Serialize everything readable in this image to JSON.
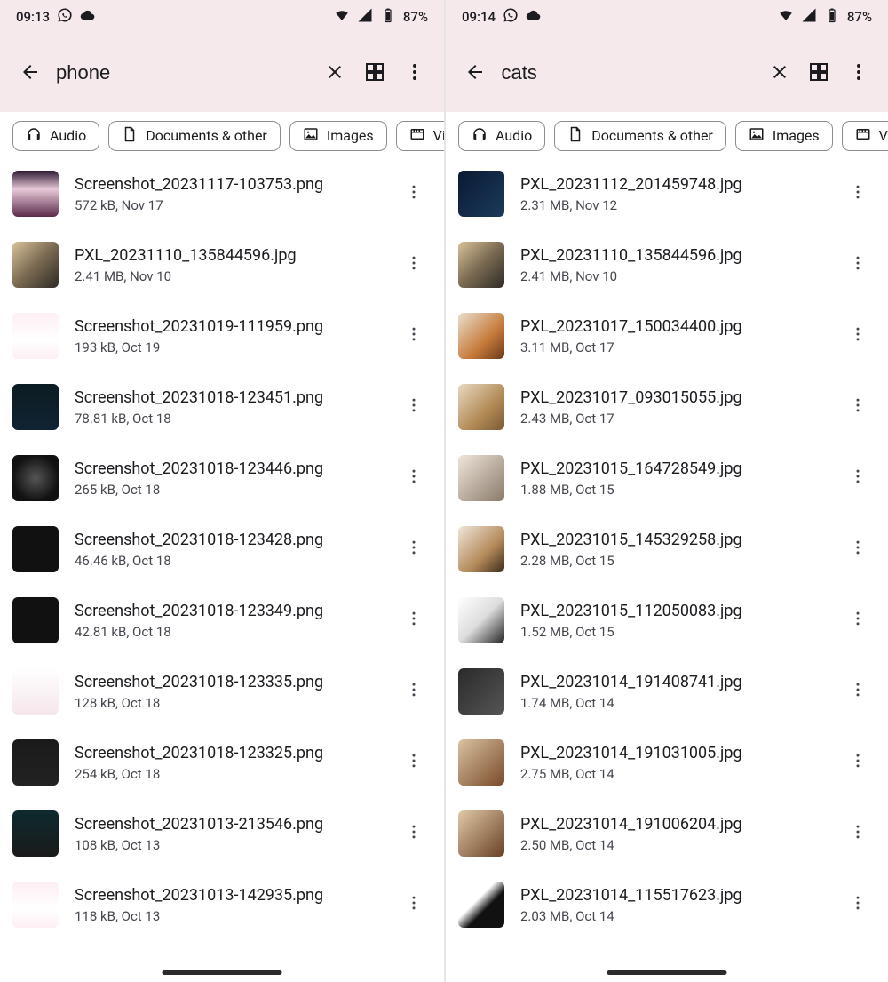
{
  "battery_label": "87%",
  "chips": [
    {
      "icon": "headphones",
      "label": "Audio"
    },
    {
      "icon": "doc",
      "label": "Documents & other"
    },
    {
      "icon": "image",
      "label": "Images"
    },
    {
      "icon": "video",
      "label": "Vi"
    }
  ],
  "panes": [
    {
      "time": "09:13",
      "query": "phone",
      "files": [
        {
          "name": "Screenshot_20231117-103753.png",
          "meta": "572 kB, Nov 17",
          "thumb": "ss-pink"
        },
        {
          "name": "PXL_20231110_135844596.jpg",
          "meta": "2.41 MB, Nov 10",
          "thumb": "cat-laptop"
        },
        {
          "name": "Screenshot_20231019-111959.png",
          "meta": "193 kB, Oct 19",
          "thumb": "ss-light"
        },
        {
          "name": "Screenshot_20231018-123451.png",
          "meta": "78.81 kB, Oct 18",
          "thumb": "ss-dark"
        },
        {
          "name": "Screenshot_20231018-123446.png",
          "meta": "265 kB, Oct 18",
          "thumb": "ss-dark2"
        },
        {
          "name": "Screenshot_20231018-123428.png",
          "meta": "46.46 kB, Oct 18",
          "thumb": "ss-black"
        },
        {
          "name": "Screenshot_20231018-123349.png",
          "meta": "42.81 kB, Oct 18",
          "thumb": "ss-black"
        },
        {
          "name": "Screenshot_20231018-123335.png",
          "meta": "128 kB, Oct 18",
          "thumb": "ss-light2"
        },
        {
          "name": "Screenshot_20231018-123325.png",
          "meta": "254 kB, Oct 18",
          "thumb": "ss-dark3"
        },
        {
          "name": "Screenshot_20231013-213546.png",
          "meta": "108 kB, Oct 13",
          "thumb": "ss-dark4"
        },
        {
          "name": "Screenshot_20231013-142935.png",
          "meta": "118 kB, Oct 13",
          "thumb": "ss-light"
        }
      ]
    },
    {
      "time": "09:14",
      "query": "cats",
      "files": [
        {
          "name": "PXL_20231112_201459748.jpg",
          "meta": "2.31 MB, Nov 12",
          "thumb": "cat-dark"
        },
        {
          "name": "PXL_20231110_135844596.jpg",
          "meta": "2.41 MB, Nov 10",
          "thumb": "cat-laptop"
        },
        {
          "name": "PXL_20231017_150034400.jpg",
          "meta": "3.11 MB, Oct 17",
          "thumb": "cat-orange"
        },
        {
          "name": "PXL_20231017_093015055.jpg",
          "meta": "2.43 MB, Oct 17",
          "thumb": "cat-tabby"
        },
        {
          "name": "PXL_20231015_164728549.jpg",
          "meta": "1.88 MB, Oct 15",
          "thumb": "cat-two"
        },
        {
          "name": "PXL_20231015_145329258.jpg",
          "meta": "2.28 MB, Oct 15",
          "thumb": "cat-pair"
        },
        {
          "name": "PXL_20231015_112050083.jpg",
          "meta": "1.52 MB, Oct 15",
          "thumb": "cat-bw"
        },
        {
          "name": "PXL_20231014_191408741.jpg",
          "meta": "1.74 MB, Oct 14",
          "thumb": "cat-bag"
        },
        {
          "name": "PXL_20231014_191031005.jpg",
          "meta": "2.75 MB, Oct 14",
          "thumb": "cat-brown"
        },
        {
          "name": "PXL_20231014_191006204.jpg",
          "meta": "2.50 MB, Oct 14",
          "thumb": "cat-brown2"
        },
        {
          "name": "PXL_20231014_115517623.jpg",
          "meta": "2.03 MB, Oct 14",
          "thumb": "cat-tux"
        }
      ]
    }
  ]
}
